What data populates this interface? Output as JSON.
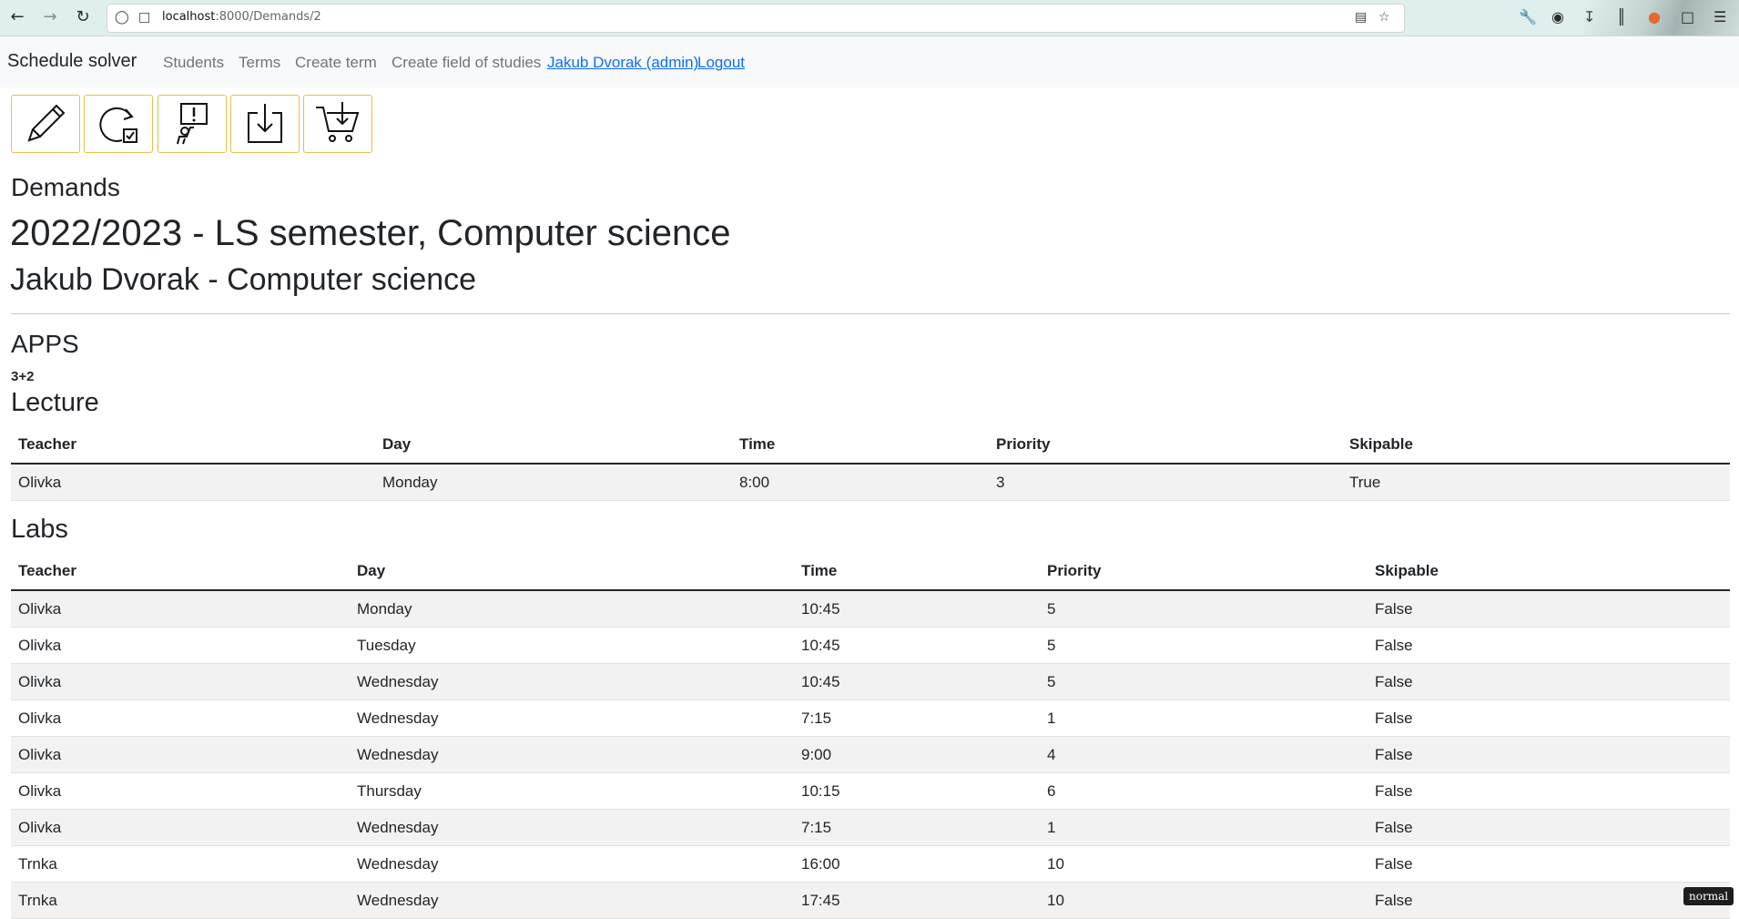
{
  "browser": {
    "url_host": "localhost",
    "url_path": ":8000/Demands/2"
  },
  "navbar": {
    "brand": "Schedule solver",
    "links": [
      "Students",
      "Terms",
      "Create term",
      "Create field of studies"
    ],
    "user": "Jakub Dvorak (admin)",
    "logout": "Logout"
  },
  "toolbar": {
    "icons": [
      "pencil-icon",
      "refresh-check-icon",
      "report-alert-icon",
      "download-icon",
      "cart-download-icon"
    ]
  },
  "page": {
    "subtitle": "Demands",
    "term": "2022/2023 - LS semester, Computer science",
    "student": "Jakub Dvorak - Computer science"
  },
  "course": {
    "name": "APPS",
    "hours": "3+2",
    "lecture": {
      "title": "Lecture",
      "headers": [
        "Teacher",
        "Day",
        "Time",
        "Priority",
        "Skipable"
      ],
      "rows": [
        [
          "Olivka",
          "Monday",
          "8:00",
          "3",
          "True"
        ]
      ]
    },
    "labs": {
      "title": "Labs",
      "headers": [
        "Teacher",
        "Day",
        "Time",
        "Priority",
        "Skipable"
      ],
      "rows": [
        [
          "Olivka",
          "Monday",
          "10:45",
          "5",
          "False"
        ],
        [
          "Olivka",
          "Tuesday",
          "10:45",
          "5",
          "False"
        ],
        [
          "Olivka",
          "Wednesday",
          "10:45",
          "5",
          "False"
        ],
        [
          "Olivka",
          "Wednesday",
          "7:15",
          "1",
          "False"
        ],
        [
          "Olivka",
          "Wednesday",
          "9:00",
          "4",
          "False"
        ],
        [
          "Olivka",
          "Thursday",
          "10:15",
          "6",
          "False"
        ],
        [
          "Olivka",
          "Wednesday",
          "7:15",
          "1",
          "False"
        ],
        [
          "Trnka",
          "Wednesday",
          "16:00",
          "10",
          "False"
        ],
        [
          "Trnka",
          "Wednesday",
          "17:45",
          "10",
          "False"
        ]
      ]
    }
  },
  "status_badge": "normal"
}
